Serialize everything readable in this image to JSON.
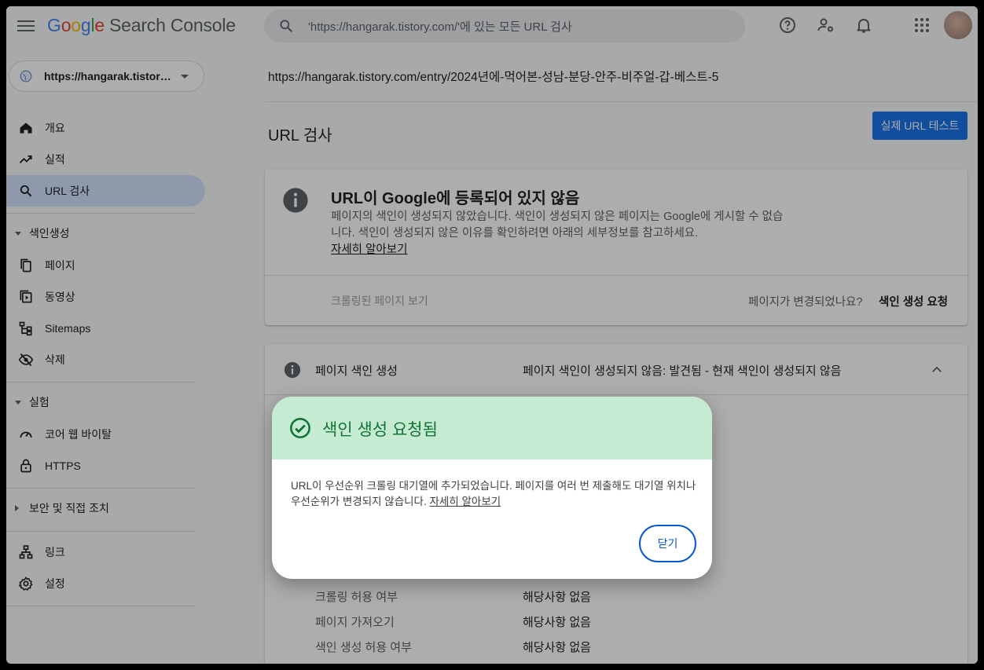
{
  "header": {
    "logo_letters": [
      "G",
      "o",
      "o",
      "g",
      "l",
      "e"
    ],
    "product_name": "Search Console",
    "search_placeholder": "'https://hangarak.tistory.com/'에 있는 모든 URL 검사"
  },
  "sidebar": {
    "property": "https://hangarak.tistory.com/",
    "items": [
      {
        "label": "개요",
        "icon": "home-icon"
      },
      {
        "label": "실적",
        "icon": "trending-up-icon"
      },
      {
        "label": "URL 검사",
        "icon": "search-icon",
        "active": true
      }
    ],
    "section_indexing": "색인생성",
    "indexing_items": [
      {
        "label": "페이지",
        "icon": "pages-icon"
      },
      {
        "label": "동영상",
        "icon": "video-icon"
      },
      {
        "label": "Sitemaps",
        "icon": "sitemap-icon"
      },
      {
        "label": "삭제",
        "icon": "visibility-off-icon"
      }
    ],
    "section_experience": "실험",
    "experience_items": [
      {
        "label": "코어 웹 바이탈",
        "icon": "speed-icon"
      },
      {
        "label": "HTTPS",
        "icon": "lock-icon"
      }
    ],
    "section_security": "보안 및 직접 조치",
    "bottom_items": [
      {
        "label": "링크",
        "icon": "links-icon"
      },
      {
        "label": "설정",
        "icon": "gear-icon"
      }
    ]
  },
  "main": {
    "inspected_url": "https://hangarak.tistory.com/entry/2024년에-먹어본-성남-분당-안주-비주얼-갑-베스트-5",
    "page_title": "URL 검사",
    "live_test_button": "실제 URL 테스트",
    "status_card": {
      "title": "URL이 Google에 등록되어 있지 않음",
      "description": "페이지의 색인이 생성되지 않았습니다. 색인이 생성되지 않은 페이지는 Google에 게시할 수 없습니다. 색인이 생성되지 않은 이유를 확인하려면 아래의 세부정보를 참고하세요.",
      "learn_more": "자세히 알아보기",
      "view_crawled": "크롤링된 페이지 보기",
      "changed_question": "페이지가 변경되었나요?",
      "request_indexing": "색인 생성 요청"
    },
    "indexing_card": {
      "label": "페이지 색인 생성",
      "status": "페이지 색인이 생성되지 않음: 발견됨 - 현재 색인이 생성되지 않음",
      "rows": [
        {
          "label": "크롤링 허용 여부",
          "value": "해당사항 없음"
        },
        {
          "label": "페이지 가져오기",
          "value": "해당사항 없음"
        },
        {
          "label": "색인 생성 허용 여부",
          "value": "해당사항 없음"
        }
      ]
    }
  },
  "dialog": {
    "title": "색인 생성 요청됨",
    "body": "URL이 우선순위 크롤링 대기열에 추가되었습니다. 페이지를 여러 번 제출해도 대기열 위치나 우선순위가 변경되지 않습니다.",
    "learn_more": "자세히 알아보기",
    "close_button": "닫기"
  },
  "colors": {
    "accent": "#1a73e8",
    "dialog_header_bg": "#c5ecd3",
    "success_green": "#137333",
    "active_nav_bg": "#d2e3fc"
  }
}
